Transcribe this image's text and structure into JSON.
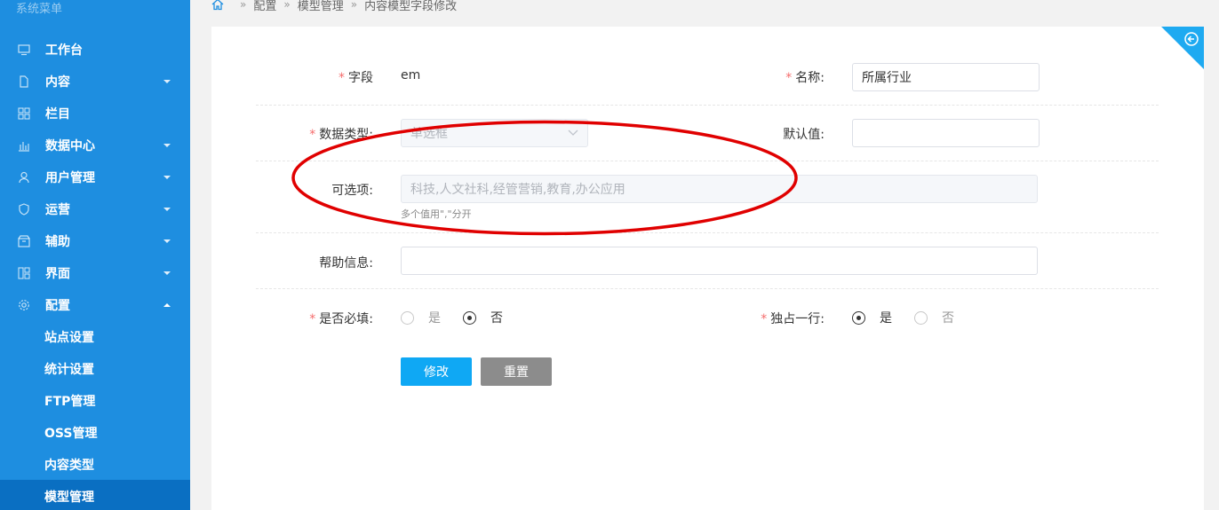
{
  "sidebar": {
    "title": "系统菜单",
    "items": [
      {
        "label": "工作台",
        "icon": "monitor-icon",
        "arrow": "none"
      },
      {
        "label": "内容",
        "icon": "document-icon",
        "arrow": "down"
      },
      {
        "label": "栏目",
        "icon": "grid-icon",
        "arrow": "none"
      },
      {
        "label": "数据中心",
        "icon": "bar-chart-icon",
        "arrow": "down"
      },
      {
        "label": "用户管理",
        "icon": "user-icon",
        "arrow": "down"
      },
      {
        "label": "运营",
        "icon": "shield-icon",
        "arrow": "down"
      },
      {
        "label": "辅助",
        "icon": "box-icon",
        "arrow": "down"
      },
      {
        "label": "界面",
        "icon": "layout-icon",
        "arrow": "down"
      },
      {
        "label": "配置",
        "icon": "gear-icon",
        "arrow": "up"
      }
    ],
    "sub_items": [
      {
        "label": "站点设置"
      },
      {
        "label": "统计设置"
      },
      {
        "label": "FTP管理"
      },
      {
        "label": "OSS管理"
      },
      {
        "label": "内容类型"
      },
      {
        "label": "模型管理"
      }
    ]
  },
  "breadcrumb": [
    "配置",
    "模型管理",
    "内容模型字段修改"
  ],
  "form": {
    "field_label": "字段",
    "field_value": "em",
    "name_label": "名称:",
    "name_value": "所属行业",
    "datatype_label": "数据类型:",
    "datatype_value": "单选框",
    "default_label": "默认值:",
    "default_value": "",
    "options_label": "可选项:",
    "options_value": "科技,人文社科,经管营销,教育,办公应用",
    "options_hint": "多个值用\",\"分开",
    "help_label": "帮助信息:",
    "help_value": "",
    "required_label": "是否必填:",
    "required_yes": "是",
    "required_no": "否",
    "required_selected": "否",
    "fullrow_label": "独占一行:",
    "fullrow_yes": "是",
    "fullrow_no": "否",
    "fullrow_selected": "是",
    "submit_label": "修改",
    "reset_label": "重置"
  },
  "colors": {
    "sidebar_bg": "#1e8ee0",
    "sidebar_active": "#0a6fc2",
    "primary": "#0fa8f4",
    "required": "#f56c6c",
    "annotation": "#e00000"
  }
}
